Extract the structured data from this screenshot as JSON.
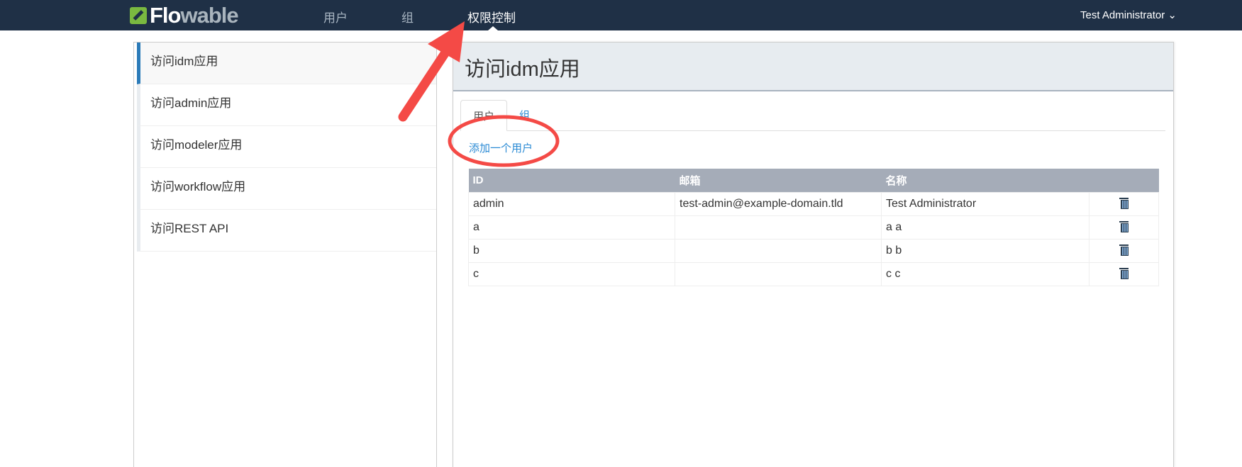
{
  "brand": {
    "part1": "Flo",
    "part2": "wable"
  },
  "nav": {
    "items": [
      "用户",
      "组",
      "权限控制"
    ],
    "user": "Test Administrator"
  },
  "sidebar": {
    "items": [
      "访问idm应用",
      "访问admin应用",
      "访问modeler应用",
      "访问workflow应用",
      "访问REST API"
    ]
  },
  "panel": {
    "title": "访问idm应用",
    "tabs": [
      "用户",
      "组"
    ],
    "add_link": "添加一个用户"
  },
  "table": {
    "headers": [
      "ID",
      "邮箱",
      "名称"
    ],
    "rows": [
      [
        "admin",
        "test-admin@example-domain.tld",
        "Test Administrator"
      ],
      [
        "a",
        "",
        "a a"
      ],
      [
        "b",
        "",
        "b b"
      ],
      [
        "c",
        "",
        "c c"
      ]
    ]
  },
  "colors": {
    "nav_bg": "#1f3046",
    "accent": "#2a8ad4",
    "annotation": "#f44a46"
  }
}
